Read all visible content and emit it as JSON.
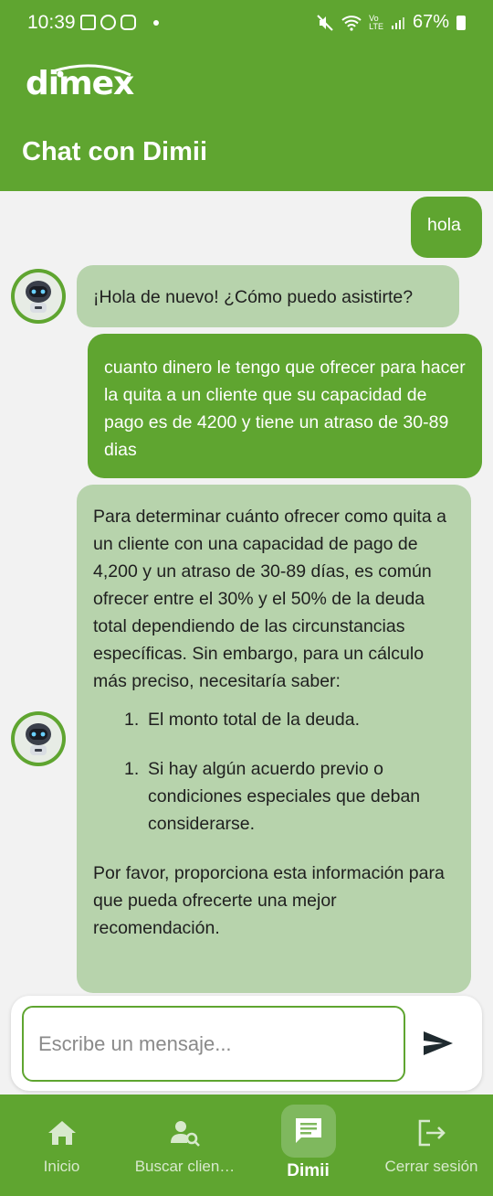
{
  "status_bar": {
    "time": "10:39",
    "battery": "67%",
    "icons_left": [
      "gallery-icon",
      "whatsapp-icon",
      "instagram-icon",
      "dot-icon"
    ],
    "icons_right": [
      "mute-icon",
      "wifi-icon",
      "volte-icon",
      "signal-icon",
      "battery-icon"
    ]
  },
  "header": {
    "logo_text": "dimex",
    "title": "Chat con Dimii"
  },
  "messages": [
    {
      "role": "user",
      "text": "hola"
    },
    {
      "role": "bot",
      "text": "¡Hola de nuevo! ¿Cómo puedo asistirte?"
    },
    {
      "role": "user",
      "text": "cuanto dinero le tengo que ofrecer para hacer la quita a un cliente que su capacidad de pago es de 4200 y tiene un atraso de 30-89 dias"
    },
    {
      "role": "bot",
      "intro": "Para determinar cuánto ofrecer como quita a un cliente con una capacidad de pago de 4,200 y un atraso de 30-89 días, es común ofrecer entre el 30% y el 50% de la deuda total dependiendo de las circunstancias específicas. Sin embargo, para un cálculo más preciso, necesitaría saber:",
      "list": [
        {
          "num": "1.",
          "text": "El monto total de la deuda."
        },
        {
          "num": "1.",
          "text": "Si hay algún acuerdo previo o condiciones especiales que deban considerarse."
        }
      ],
      "outro": "Por favor, proporciona esta información para que pueda ofrecerte una mejor recomendación."
    }
  ],
  "composer": {
    "placeholder": "Escribe un mensaje..."
  },
  "nav": {
    "items": [
      {
        "label": "Inicio",
        "icon": "home-icon"
      },
      {
        "label": "Buscar clien…",
        "icon": "search-user-icon"
      },
      {
        "label": "Dimii",
        "icon": "chat-icon",
        "active": true
      },
      {
        "label": "Cerrar sesión",
        "icon": "logout-icon"
      }
    ]
  },
  "colors": {
    "brand_green": "#5fa530",
    "bot_bubble": "#b7d3ac",
    "background": "#f2f2f2"
  }
}
